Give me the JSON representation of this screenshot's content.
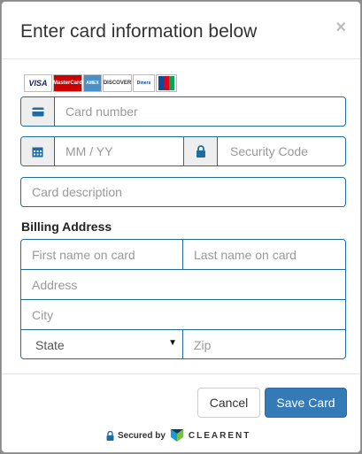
{
  "modal": {
    "title": "Enter card information below",
    "close_label": "×"
  },
  "card_logos": [
    {
      "name": "visa-logo",
      "text": "VISA",
      "color": "#1a1f71"
    },
    {
      "name": "mastercard-logo",
      "text": "MasterCard",
      "color": "#cc0000"
    },
    {
      "name": "amex-logo",
      "text": "AMEX",
      "color": "#4a90c8"
    },
    {
      "name": "discover-logo",
      "text": "DISCOVER",
      "color": "#e87722"
    },
    {
      "name": "diners-club-logo",
      "text": "Diners Club",
      "color": "#004a97"
    },
    {
      "name": "jcb-logo",
      "text": "JCB",
      "color": "#00a650"
    }
  ],
  "fields": {
    "card_number_placeholder": "Card number",
    "expiry_placeholder": "MM / YY",
    "security_code_placeholder": "Security Code",
    "card_description_placeholder": "Card description"
  },
  "billing": {
    "heading": "Billing Address",
    "first_name_placeholder": "First name on card",
    "last_name_placeholder": "Last name on card",
    "address_placeholder": "Address",
    "city_placeholder": "City",
    "state_selected": "State",
    "zip_placeholder": "Zip"
  },
  "buttons": {
    "cancel_label": "Cancel",
    "save_label": "Save Card"
  },
  "footer": {
    "secured_by": "Secured by",
    "brand": "CLEARENT"
  },
  "colors": {
    "accent": "#337ab7",
    "field_border": "#1f6ca3",
    "icon": "#1f6ca3"
  },
  "icons": {
    "card": "credit-card-icon",
    "calendar": "calendar-icon",
    "lock": "lock-icon"
  }
}
